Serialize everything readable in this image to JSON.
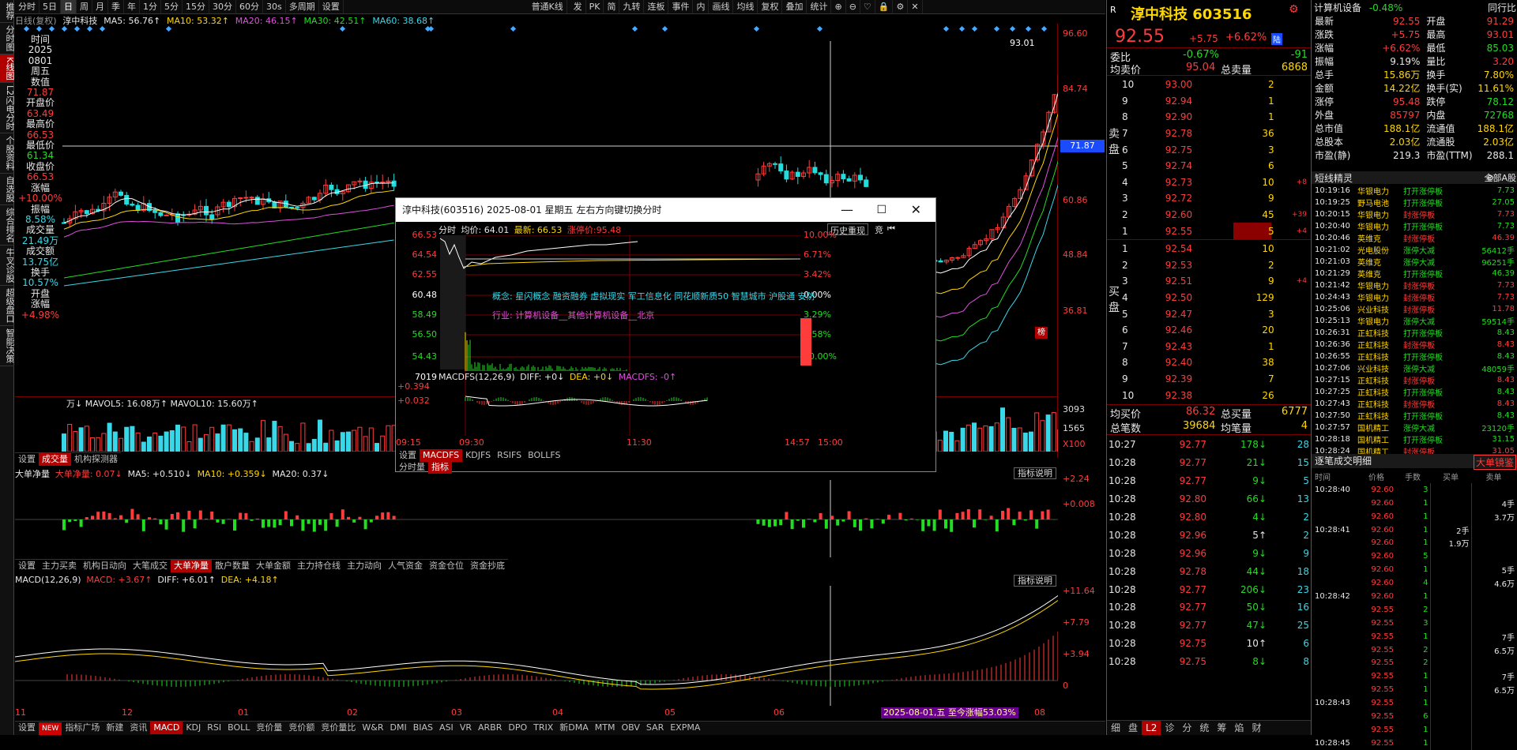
{
  "left_sidebar": [
    "推荐",
    "分时图",
    "K线图",
    "L2闪电分时",
    "个股资料",
    "自选股",
    "综合排名",
    "牛叉诊股",
    "超级盘口",
    "智能决策"
  ],
  "topbar": {
    "items": [
      "分时",
      "5日",
      "日",
      "周",
      "月",
      "季",
      "年",
      "1分",
      "5分",
      "15分",
      "30分",
      "60分",
      "30s",
      "多周期",
      "设置"
    ],
    "active": "日",
    "kline_type": "普通K线",
    "right_items": [
      "发",
      "PK",
      "简",
      "九转",
      "连板",
      "事件",
      "内",
      "画线",
      "均线",
      "复权",
      "叠加",
      "统计"
    ]
  },
  "kline": {
    "header": {
      "period": "日线(复权)",
      "name": "淳中科技",
      "ma5": "MA5: 56.76↑",
      "ma10": "MA10: 53.32↑",
      "ma20": "MA20: 46.15↑",
      "ma30": "MA30: 42.51↑",
      "ma60": "MA60: 38.68↑"
    },
    "y_axis": [
      "96.60",
      "84.74",
      "72.87",
      "60.86",
      "48.84",
      "36.81"
    ],
    "price_tag": "71.87",
    "high_label": "93.01",
    "badge": "榜",
    "info": [
      [
        "时间",
        "w"
      ],
      [
        "2025",
        "w"
      ],
      [
        "0801",
        "w"
      ],
      [
        "周五",
        "w"
      ],
      [
        "数值",
        "w"
      ],
      [
        "71.87",
        "r"
      ],
      [
        "开盘价",
        "w"
      ],
      [
        "63.49",
        "r"
      ],
      [
        "最高价",
        "w"
      ],
      [
        "66.53",
        "r"
      ],
      [
        "最低价",
        "w"
      ],
      [
        "61.34",
        "g"
      ],
      [
        "收盘价",
        "w"
      ],
      [
        "66.53",
        "r"
      ],
      [
        "涨幅",
        "w"
      ],
      [
        "+10.00%",
        "r"
      ],
      [
        "振幅",
        "w"
      ],
      [
        "8.58%",
        "c"
      ],
      [
        "成交量",
        "w"
      ],
      [
        "21.49万",
        "c"
      ],
      [
        "成交额",
        "w"
      ],
      [
        "13.75亿",
        "c"
      ],
      [
        "换手",
        "w"
      ],
      [
        "10.57%",
        "c"
      ],
      [
        "开盘",
        "w"
      ],
      [
        "涨幅",
        "w"
      ],
      [
        "+4.98%",
        "r"
      ]
    ]
  },
  "volume": {
    "header": "万↓ MAVOL5: 16.08万↑ MAVOL10: 15.60万↑",
    "y": [
      "3093",
      "1565",
      "X100"
    ],
    "tabs": [
      "设置",
      "成交量",
      "机构探测器"
    ],
    "active": "成交量"
  },
  "bigorder": {
    "header_name": "大单净量",
    "header_val": "大单净量: 0.07↓",
    "ma5": "MA5: +0.510↓",
    "ma10": "MA10: +0.359↓",
    "ma20": "MA20: 0.37↓",
    "y": [
      "+2.24",
      "+0.008"
    ],
    "btn": "指标说明",
    "tabs": [
      "设置",
      "主力买卖",
      "机构日动向",
      "大笔成交",
      "大单净量",
      "散户数量",
      "大单金额",
      "主力持仓线",
      "主力动向",
      "人气资金",
      "资金仓位",
      "资金抄底"
    ],
    "active": "大单净量"
  },
  "macd": {
    "header_name": "MACD(12,26,9)",
    "macd": "MACD: +3.67↑",
    "diff": "DIFF: +6.01↑",
    "dea": "DEA: +4.18↑",
    "y": [
      "+11.64",
      "+7.79",
      "+3.94",
      "0"
    ],
    "btn": "指标说明",
    "x_labels": [
      "11",
      "12",
      "01",
      "02",
      "03",
      "04",
      "05",
      "06",
      "07",
      "08"
    ],
    "range_label": "2025-08-01,五 至今涨幅53.03%"
  },
  "bottom_tabs": {
    "items": [
      "设置",
      "NEW",
      "指标广场",
      "新建",
      "资讯",
      "MACD",
      "KDJ",
      "RSI",
      "BOLL",
      "竞价量",
      "竞价额",
      "竞价量比",
      "W&R",
      "DMI",
      "BIAS",
      "ASI",
      "VR",
      "ARBR",
      "DPO",
      "TRIX",
      "新DMA",
      "MTM",
      "OBV",
      "SAR",
      "EXPMA"
    ],
    "active": "MACD"
  },
  "popup": {
    "title": "淳中科技(603516) 2025-08-01 星期五     左右方向键切换分时",
    "header_label": "分时",
    "avg": "均价: 64.01",
    "latest": "最新: 66.53",
    "limit": "涨停价:95.48",
    "btn": "历史重现",
    "btn2": "竞",
    "y_left": [
      "66.53",
      "64.54",
      "62.55",
      "60.48",
      "58.49",
      "56.50",
      "54.43",
      "7019"
    ],
    "y_right": [
      "10.00%",
      "6.71%",
      "3.42%",
      "0.00%",
      "3.29%",
      "6.58%",
      "10.00%"
    ],
    "concept": "概念: 星闪概念  融资融券  虚拟现实  军工信息化  同花顺新质50  智慧城市  沪股通  安防",
    "industry": "行业: 计算机设备__其他计算机设备__北京",
    "macd_header": "MACDFS(12,26,9)",
    "diff": "DIFF: +0↓",
    "dea": "DEA: +0↓",
    "macdfs": "MACDFS: -0↑",
    "macd_y": [
      "+0.394",
      "+0.032"
    ],
    "x": [
      "09:15",
      "09:30",
      "11:30",
      "14:57",
      "15:00"
    ],
    "tabs": [
      "设置",
      "MACDFS",
      "KDJFS",
      "RSIFS",
      "BOLLFS"
    ],
    "active": "MACDFS",
    "tabs2": [
      "分时量",
      "指标"
    ],
    "active2": "指标"
  },
  "quote": {
    "code_label": "R",
    "name": "淳中科技 603516",
    "price": "92.55",
    "chg": "+5.75",
    "pct": "+6.62%",
    "flag": "陆",
    "weibi_l": "委比",
    "weibi": "-0.67%",
    "weicha": "-91",
    "avg_l": "均卖价",
    "avg": "95.04",
    "tot_l": "总卖量",
    "tot": "6868",
    "asks": [
      [
        "10",
        "93.00",
        "2",
        ""
      ],
      [
        "9",
        "92.94",
        "1",
        ""
      ],
      [
        "8",
        "92.90",
        "1",
        ""
      ],
      [
        "7",
        "92.78",
        "36",
        ""
      ],
      [
        "6",
        "92.75",
        "3",
        ""
      ],
      [
        "5",
        "92.74",
        "6",
        ""
      ],
      [
        "4",
        "92.73",
        "10",
        "+8"
      ],
      [
        "3",
        "92.72",
        "9",
        ""
      ],
      [
        "2",
        "92.60",
        "45",
        "+39"
      ],
      [
        "1",
        "92.55",
        "5",
        "+4"
      ]
    ],
    "bids": [
      [
        "1",
        "92.54",
        "10",
        ""
      ],
      [
        "2",
        "92.53",
        "2",
        ""
      ],
      [
        "3",
        "92.51",
        "9",
        "+4"
      ],
      [
        "4",
        "92.50",
        "129",
        ""
      ],
      [
        "5",
        "92.47",
        "3",
        ""
      ],
      [
        "6",
        "92.46",
        "20",
        ""
      ],
      [
        "7",
        "92.43",
        "1",
        ""
      ],
      [
        "8",
        "92.40",
        "38",
        ""
      ],
      [
        "9",
        "92.39",
        "7",
        ""
      ],
      [
        "10",
        "92.38",
        "26",
        ""
      ]
    ],
    "sell_label": "卖盘",
    "buy_label": "买盘",
    "bavg_l": "均买价",
    "bavg": "86.32",
    "btot_l": "总买量",
    "btot": "6777",
    "cnt_l": "总笔数",
    "cnt": "39684",
    "avgvol_l": "均笔量",
    "avgvol": "4"
  },
  "ticks": [
    [
      "10:27",
      "92.77",
      "178",
      "↓",
      "28"
    ],
    [
      "10:28",
      "92.77",
      "21",
      "↓",
      "15"
    ],
    [
      "10:28",
      "92.77",
      "9",
      "↓",
      "5"
    ],
    [
      "10:28",
      "92.80",
      "66",
      "↓",
      "13"
    ],
    [
      "10:28",
      "92.80",
      "4",
      "↓",
      "2"
    ],
    [
      "10:28",
      "92.96",
      "5",
      "↑",
      "2"
    ],
    [
      "10:28",
      "92.96",
      "9",
      "↓",
      "9"
    ],
    [
      "10:28",
      "92.78",
      "44",
      "↓",
      "18"
    ],
    [
      "10:28",
      "92.77",
      "206",
      "↓",
      "23"
    ],
    [
      "10:28",
      "92.77",
      "50",
      "↓",
      "16"
    ],
    [
      "10:28",
      "92.77",
      "47",
      "↓",
      "25"
    ],
    [
      "10:28",
      "92.75",
      "10",
      "↑",
      "6"
    ],
    [
      "10:28",
      "92.75",
      "8",
      "↓",
      "8"
    ]
  ],
  "ticks_tabs": [
    "细",
    "盘",
    "L2",
    "诊",
    "分",
    "统",
    "筹",
    "焰",
    "财"
  ],
  "right": {
    "sector": "计算机设备",
    "sector_pct": "-0.48%",
    "peer": "同行比",
    "rows": [
      [
        "最新",
        "92.55",
        "r",
        "开盘",
        "91.29",
        "r"
      ],
      [
        "涨跌",
        "+5.75",
        "r",
        "最高",
        "93.01",
        "r"
      ],
      [
        "涨幅",
        "+6.62%",
        "r",
        "最低",
        "85.03",
        "g"
      ],
      [
        "振幅",
        "9.19%",
        "w",
        "量比",
        "3.20",
        "r"
      ],
      [
        "总手",
        "15.86万",
        "y",
        "换手",
        "7.80%",
        "y"
      ],
      [
        "金额",
        "14.22亿",
        "y",
        "换手(实)",
        "11.61%",
        "y"
      ],
      [
        "涨停",
        "95.48",
        "r",
        "跌停",
        "78.12",
        "g"
      ],
      [
        "外盘",
        "85797",
        "r",
        "内盘",
        "72768",
        "g"
      ],
      [
        "总市值",
        "188.1亿",
        "y",
        "流通值",
        "188.1亿",
        "y"
      ],
      [
        "总股本",
        "2.03亿",
        "y",
        "流通股",
        "2.03亿",
        "y"
      ],
      [
        "市盈(静)",
        "219.3",
        "w",
        "市盈(TTM)",
        "288.1",
        "w"
      ]
    ],
    "news_title": "短线精灵",
    "news_sel": "全部A股",
    "news": [
      [
        "10:19:16",
        "华银电力",
        "打开涨停板",
        "7.73"
      ],
      [
        "10:19:25",
        "野马电池",
        "打开涨停板",
        "27.05"
      ],
      [
        "10:20:15",
        "华银电力",
        "封涨停板",
        "7.73"
      ],
      [
        "10:20:40",
        "华银电力",
        "打开涨停板",
        "7.73"
      ],
      [
        "10:20:46",
        "英维克",
        "封涨停板",
        "46.39"
      ],
      [
        "10:21:02",
        "光电股份",
        "涨停大减",
        "56412手"
      ],
      [
        "10:21:03",
        "英维克",
        "涨停大减",
        "96251手"
      ],
      [
        "10:21:29",
        "英维克",
        "打开涨停板",
        "46.39"
      ],
      [
        "10:21:42",
        "华银电力",
        "封涨停板",
        "7.73"
      ],
      [
        "10:24:43",
        "华银电力",
        "封涨停板",
        "7.73"
      ],
      [
        "10:25:06",
        "兴业科技",
        "封涨停板",
        "11.78"
      ],
      [
        "10:25:13",
        "华银电力",
        "涨停大减",
        "59514手"
      ],
      [
        "10:26:31",
        "正虹科技",
        "打开涨停板",
        "8.43"
      ],
      [
        "10:26:36",
        "正虹科技",
        "封涨停板",
        "8.43"
      ],
      [
        "10:26:55",
        "正虹科技",
        "打开涨停板",
        "8.43"
      ],
      [
        "10:27:06",
        "兴业科技",
        "涨停大减",
        "48059手"
      ],
      [
        "10:27:15",
        "正虹科技",
        "封涨停板",
        "8.43"
      ],
      [
        "10:27:25",
        "正虹科技",
        "打开涨停板",
        "8.43"
      ],
      [
        "10:27:43",
        "正虹科技",
        "封涨停板",
        "8.43"
      ],
      [
        "10:27:50",
        "正虹科技",
        "打开涨停板",
        "8.43"
      ],
      [
        "10:27:57",
        "国机精工",
        "涨停大减",
        "23120手"
      ],
      [
        "10:28:18",
        "国机精工",
        "打开涨停板",
        "31.15"
      ],
      [
        "10:28:24",
        "国机精工",
        "封涨停板",
        "31.05"
      ]
    ],
    "det_title": "逐笔成交明细",
    "det_btn": "大单镜鉴",
    "det_head": [
      "时间",
      "价格",
      "手数",
      "买单",
      "卖单"
    ],
    "det": [
      [
        "10:28:40",
        "92.60",
        "3",
        "",
        ""
      ],
      [
        "",
        "92.60",
        "1",
        "",
        "4手"
      ],
      [
        "",
        "92.60",
        "1",
        "",
        "3.7万"
      ],
      [
        "10:28:41",
        "92.60",
        "1",
        "2手",
        ""
      ],
      [
        "",
        "92.60",
        "1",
        "1.9万",
        ""
      ],
      [
        "",
        "92.60",
        "5",
        "",
        ""
      ],
      [
        "",
        "92.60",
        "1",
        "",
        "5手"
      ],
      [
        "",
        "92.60",
        "4",
        "",
        "4.6万"
      ],
      [
        "10:28:42",
        "92.60",
        "1",
        "",
        ""
      ],
      [
        "",
        "92.55",
        "2",
        "",
        ""
      ],
      [
        "",
        "92.55",
        "3",
        "",
        ""
      ],
      [
        "",
        "92.55",
        "1",
        "",
        "7手"
      ],
      [
        "",
        "92.55",
        "2",
        "",
        "6.5万"
      ],
      [
        "",
        "92.55",
        "2",
        "",
        ""
      ],
      [
        "",
        "92.55",
        "1",
        "",
        "7手"
      ],
      [
        "",
        "92.55",
        "1",
        "",
        "6.5万"
      ],
      [
        "10:28:43",
        "92.55",
        "1",
        "",
        ""
      ],
      [
        "",
        "92.55",
        "6",
        "",
        ""
      ],
      [
        "",
        "92.55",
        "1",
        "",
        ""
      ],
      [
        "10:28:45",
        "92.55",
        "1",
        "",
        ""
      ]
    ]
  }
}
